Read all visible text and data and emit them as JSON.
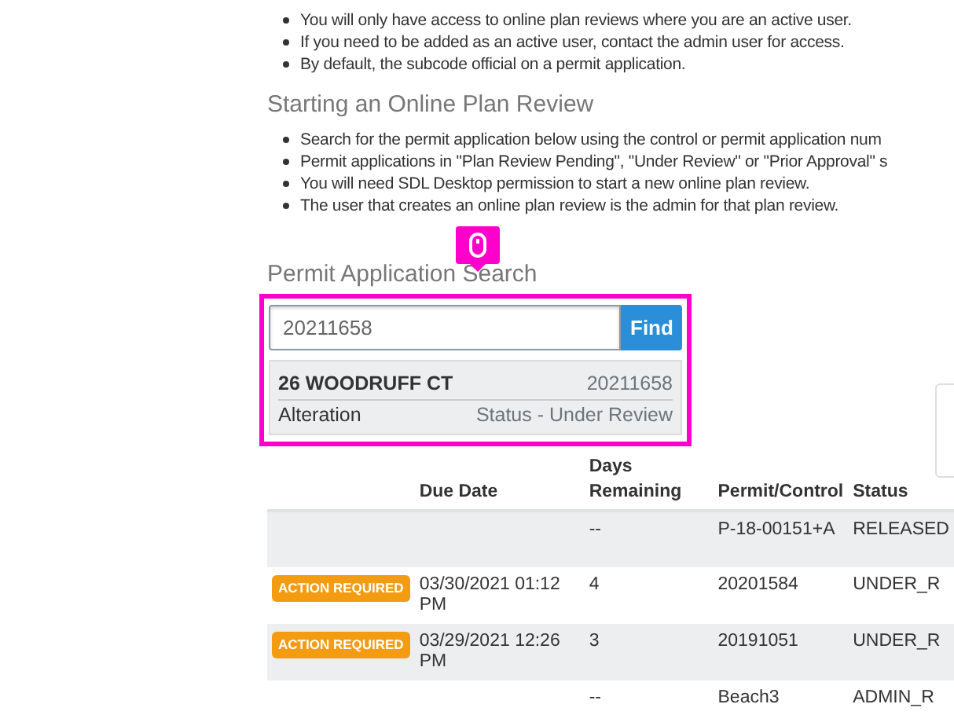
{
  "access_notes": [
    "You will only have access to online plan reviews where you are an active user.",
    "If you need to be added as an active user, contact the admin user for access.",
    "By default, the subcode official on a permit application."
  ],
  "start_section": {
    "heading": "Starting an Online Plan Review",
    "notes": [
      "Search for the permit application below using the control or permit application num",
      "Permit applications in \"Plan Review Pending\", \"Under Review\" or \"Prior Approval\" s",
      "You will need SDL Desktop permission to start a new online plan review.",
      "The user that creates an online plan review is the admin for that plan review."
    ]
  },
  "search": {
    "heading": "Permit Application Search",
    "value": "20211658",
    "button": "Find",
    "highlighted": true,
    "result": {
      "address": "26 WOODRUFF CT",
      "number": "20211658",
      "type": "Alteration",
      "status": "Status - Under Review"
    }
  },
  "table": {
    "columns": [
      "",
      "Due Date",
      "Days Remaining",
      "Permit/Control",
      "Status"
    ],
    "rows": [
      {
        "badge": "",
        "due": "",
        "days": "--",
        "permit": "P-18-00151+A",
        "status": "RELEASED"
      },
      {
        "badge": "ACTION REQUIRED",
        "due": "03/30/2021 01:12 PM",
        "days": "4",
        "permit": "20201584",
        "status": "UNDER_R"
      },
      {
        "badge": "ACTION REQUIRED",
        "due": "03/29/2021 12:26 PM",
        "days": "3",
        "permit": "20191051",
        "status": "UNDER_R"
      },
      {
        "badge": "",
        "due": "",
        "days": "--",
        "permit": "Beach3",
        "status": "ADMIN_R"
      }
    ]
  }
}
